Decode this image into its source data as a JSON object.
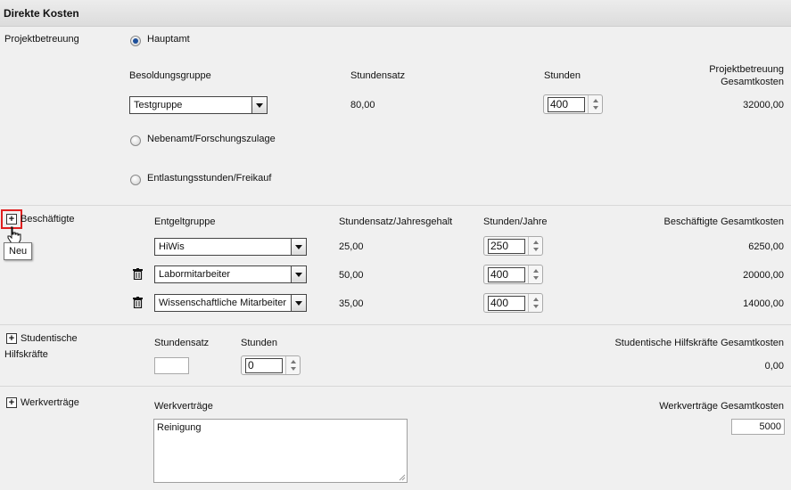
{
  "header": {
    "title": "Direkte Kosten"
  },
  "projektbetreuung": {
    "label": "Projektbetreuung",
    "radio_hauptamt": "Hauptamt",
    "col_besoldung": "Besoldungsgruppe",
    "col_stundensatz": "Stundensatz",
    "col_stunden": "Stunden",
    "col_gesamt_line1": "Projektbetreuung",
    "col_gesamt_line2": "Gesamtkosten",
    "besoldung_value": "Testgruppe",
    "stundensatz_value": "80,00",
    "stunden_value": "400",
    "gesamt_value": "32000,00",
    "radio_nebenamt": "Nebenamt/Forschungszulage",
    "radio_entlastung": "Entlastungsstunden/Freikauf"
  },
  "beschaeftigte": {
    "label": "Beschäftigte",
    "tooltip": "Neu",
    "col_entgelt": "Entgeltgruppe",
    "col_stundensatz": "Stundensatz/Jahresgehalt",
    "col_stunden": "Stunden/Jahre",
    "col_gesamt": "Beschäftigte Gesamtkosten",
    "rows": [
      {
        "entgelt": "HiWis",
        "satz": "25,00",
        "stunden": "250",
        "gesamt": "6250,00"
      },
      {
        "entgelt": "Labormitarbeiter",
        "satz": "50,00",
        "stunden": "400",
        "gesamt": "20000,00"
      },
      {
        "entgelt": "Wissenschaftliche Mitarbeiter",
        "satz": "35,00",
        "stunden": "400",
        "gesamt": "14000,00"
      }
    ]
  },
  "studentische": {
    "label_line1": "Studentische",
    "label_line2": "Hilfskräfte",
    "col_stundensatz": "Stundensatz",
    "col_stunden": "Stunden",
    "col_gesamt": "Studentische Hilfskräfte Gesamtkosten",
    "stundensatz_value": "",
    "stunden_value": "0",
    "gesamt_value": "0,00"
  },
  "werkvertraege": {
    "label": "Werkverträge",
    "col_werk": "Werkverträge",
    "col_gesamt": "Werkverträge Gesamtkosten",
    "text_value": "Reinigung",
    "gesamt_value": "5000"
  }
}
